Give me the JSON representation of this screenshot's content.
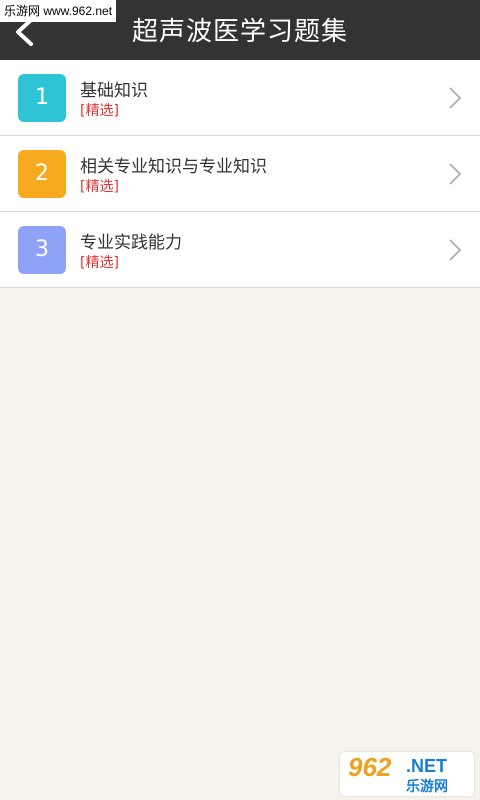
{
  "watermark_top": "乐游网 www.962.net",
  "header": {
    "title": "超声波医学习题集"
  },
  "list": [
    {
      "num": "1",
      "title": "基础知识",
      "tag": "[精选]",
      "color": "#2ec4d6"
    },
    {
      "num": "2",
      "title": "相关专业知识与专业知识",
      "tag": "[精选]",
      "color": "#f8aa1f"
    },
    {
      "num": "3",
      "title": "专业实践能力",
      "tag": "[精选]",
      "color": "#8ea2f8"
    }
  ],
  "watermark_bottom": {
    "big": "962",
    "net": ".NET",
    "cn": "乐游网"
  },
  "icons": {
    "back": "back-chevron-icon",
    "row_arrow": "chevron-right-icon"
  },
  "colors": {
    "header_bg": "#333333",
    "tag": "#e53333",
    "page_bg": "#f6f3ec"
  }
}
